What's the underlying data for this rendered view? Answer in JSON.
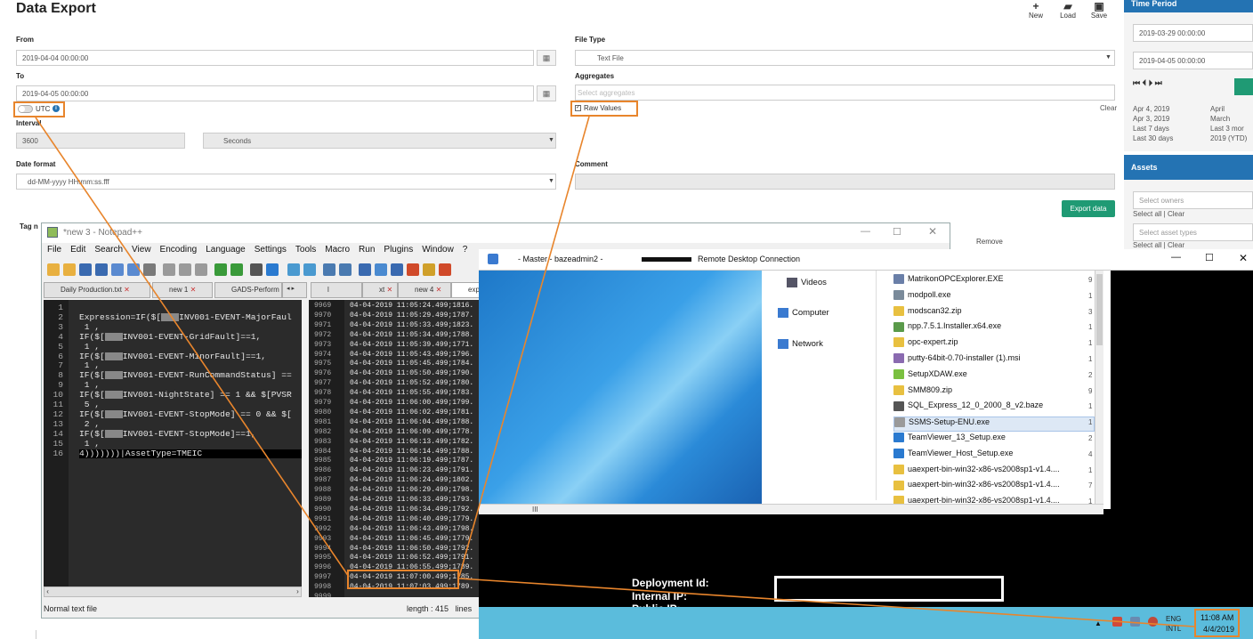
{
  "page": {
    "title": "Data Export",
    "toolbar": {
      "new_label": "New",
      "load_label": "Load",
      "save_label": "Save"
    }
  },
  "form": {
    "from_label": "From",
    "from_value": "2019-04-04 00:00:00",
    "to_label": "To",
    "to_value": "2019-04-05 00:00:00",
    "utc_label": "UTC",
    "interval_label": "Interval",
    "interval_value": "3600",
    "interval_unit": "Seconds",
    "date_format_label": "Date format",
    "date_format_value": "dd-MM-yyyy HH:mm:ss.fff",
    "file_type_label": "File Type",
    "file_type_value": "Text File",
    "aggregates_label": "Aggregates",
    "aggregates_placeholder": "Select aggregates",
    "raw_values_label": "Raw Values",
    "clear_label": "Clear",
    "comment_label": "Comment",
    "export_button": "Export data",
    "tag_label": "Tag n",
    "remove_label": "Remove"
  },
  "right_panel": {
    "time_period_heading": "Time Period",
    "start_value": "2019-03-29 00:00:00",
    "end_value": "2019-04-05 00:00:00",
    "nav_glyphs": "⏮ ⏴   ⏵ ⏭",
    "quick_left": [
      "Apr 4, 2019",
      "Apr 3, 2019",
      "Last 7 days",
      "Last 30 days"
    ],
    "quick_right": [
      "April",
      "March",
      "Last 3 mor",
      "2019 (YTD)"
    ],
    "assets_heading": "Assets",
    "owners_placeholder": "Select owners",
    "owners_links": "Select all | Clear",
    "asset_types_placeholder": "Select asset types",
    "asset_types_links": "Select all | Clear"
  },
  "notepad": {
    "title": "*new 3 - Notepad++",
    "menu": [
      "File",
      "Edit",
      "Search",
      "View",
      "Encoding",
      "Language",
      "Settings",
      "Tools",
      "Macro",
      "Run",
      "Plugins",
      "Window",
      "?"
    ],
    "tabs_left": [
      "Daily Production.txt",
      "new 1",
      "GADS-Perform"
    ],
    "tabs_right": [
      "l",
      "xt",
      "new 4",
      "exportec"
    ],
    "status_left": "Normal text file",
    "status_length": "length : 415",
    "status_lines": "lines",
    "editor_lines": [
      {
        "n": "1",
        "a": "",
        "r": false,
        "b": ""
      },
      {
        "n": "2",
        "a": "Expression=IF($[",
        "r": true,
        "b": "INV001-EVENT-MajorFaul"
      },
      {
        "n": "3",
        "a": " 1 ,",
        "r": false,
        "b": ""
      },
      {
        "n": "4",
        "a": "IF($[",
        "r": true,
        "b": "INV001-EVENT-GridFault]==1,"
      },
      {
        "n": "5",
        "a": " 1 ,",
        "r": false,
        "b": ""
      },
      {
        "n": "6",
        "a": "IF($[",
        "r": true,
        "b": "INV001-EVENT-MinorFault]==1,"
      },
      {
        "n": "7",
        "a": " 1 ,",
        "r": false,
        "b": ""
      },
      {
        "n": "8",
        "a": "IF($[",
        "r": true,
        "b": "INV001-EVENT-RunCommandStatus] =="
      },
      {
        "n": "9",
        "a": " 1 ,",
        "r": false,
        "b": ""
      },
      {
        "n": "10",
        "a": "IF($[",
        "r": true,
        "b": "INV001-NightState] == 1 && $[PVSR"
      },
      {
        "n": "11",
        "a": " 5 ,",
        "r": false,
        "b": ""
      },
      {
        "n": "12",
        "a": "IF($[",
        "r": true,
        "b": "INV001-EVENT-StopMode] == 0 && $["
      },
      {
        "n": "13",
        "a": " 2 ,",
        "r": false,
        "b": ""
      },
      {
        "n": "14",
        "a": "IF($[",
        "r": true,
        "b": "INV001-EVENT-StopMode]==1,"
      },
      {
        "n": "15",
        "a": " 1 ,",
        "r": false,
        "b": ""
      },
      {
        "n": "16",
        "a": "4)))))))|AssetType=TMEIC",
        "r": false,
        "b": ""
      }
    ],
    "data_lines": [
      {
        "n": "9969",
        "t": "04-04-2019 11:05:24.499;1816."
      },
      {
        "n": "9970",
        "t": "04-04-2019 11:05:29.499;1787."
      },
      {
        "n": "9971",
        "t": "04-04-2019 11:05:33.499;1823."
      },
      {
        "n": "9972",
        "t": "04-04-2019 11:05:34.499;1788."
      },
      {
        "n": "9973",
        "t": "04-04-2019 11:05:39.499;1771."
      },
      {
        "n": "9974",
        "t": "04-04-2019 11:05:43.499;1796."
      },
      {
        "n": "9975",
        "t": "04-04-2019 11:05:45.499;1784."
      },
      {
        "n": "9976",
        "t": "04-04-2019 11:05:50.499;1790."
      },
      {
        "n": "9977",
        "t": "04-04-2019 11:05:52.499;1780."
      },
      {
        "n": "9978",
        "t": "04-04-2019 11:05:55.499;1783."
      },
      {
        "n": "9979",
        "t": "04-04-2019 11:06:00.499;1799."
      },
      {
        "n": "9980",
        "t": "04-04-2019 11:06:02.499;1781."
      },
      {
        "n": "9981",
        "t": "04-04-2019 11:06:04.499;1788."
      },
      {
        "n": "9982",
        "t": "04-04-2019 11:06:09.499;1778."
      },
      {
        "n": "9983",
        "t": "04-04-2019 11:06:13.499;1782."
      },
      {
        "n": "9984",
        "t": "04-04-2019 11:06:14.499;1788."
      },
      {
        "n": "9985",
        "t": "04-04-2019 11:06:19.499;1787."
      },
      {
        "n": "9986",
        "t": "04-04-2019 11:06:23.499;1791."
      },
      {
        "n": "9987",
        "t": "04-04-2019 11:06:24.499;1802."
      },
      {
        "n": "9988",
        "t": "04-04-2019 11:06:29.499;1798."
      },
      {
        "n": "9989",
        "t": "04-04-2019 11:06:33.499;1793."
      },
      {
        "n": "9990",
        "t": "04-04-2019 11:06:34.499;1792."
      },
      {
        "n": "9991",
        "t": "04-04-2019 11:06:40.499;1779."
      },
      {
        "n": "9992",
        "t": "04-04-2019 11:06:43.499;1798."
      },
      {
        "n": "9993",
        "t": "04-04-2019 11:06:45.499;1779."
      },
      {
        "n": "9994",
        "t": "04-04-2019 11:06:50.499;1792."
      },
      {
        "n": "9995",
        "t": "04-04-2019 11:06:52.499;1791."
      },
      {
        "n": "9996",
        "t": "04-04-2019 11:06:55.499;1789."
      },
      {
        "n": "9997",
        "t": "04-04-2019 11:07:00.499;1785."
      },
      {
        "n": "9998",
        "t": "04-04-2019 11:07:03.499;1789."
      },
      {
        "n": "9999",
        "t": ""
      }
    ]
  },
  "rdp": {
    "title_prefix": "- Master - bazeadmin2 -",
    "title_suffix": "Remote Desktop Connection",
    "nav": [
      "Videos",
      "Computer",
      "Network"
    ],
    "files": [
      {
        "name": "MatrikonOPCExplorer.EXE",
        "size": "9",
        "color": "#6a7fa8"
      },
      {
        "name": "modpoll.exe",
        "size": "1",
        "color": "#7a8a9a"
      },
      {
        "name": "modscan32.zip",
        "size": "3",
        "color": "#e8c040"
      },
      {
        "name": "npp.7.5.1.Installer.x64.exe",
        "size": "1",
        "color": "#5a9a4a"
      },
      {
        "name": "opc-expert.zip",
        "size": "1",
        "color": "#e8c040"
      },
      {
        "name": "putty-64bit-0.70-installer (1).msi",
        "size": "1",
        "color": "#8a6ab0"
      },
      {
        "name": "SetupXDAW.exe",
        "size": "2",
        "color": "#7ac040"
      },
      {
        "name": "SMM809.zip",
        "size": "9",
        "color": "#e8c040"
      },
      {
        "name": "SQL_Express_12_0_2000_8_v2.baze",
        "size": "1",
        "color": "#555555"
      },
      {
        "name": "SSMS-Setup-ENU.exe",
        "size": "1",
        "color": "#9a9a9a"
      },
      {
        "name": "TeamViewer_13_Setup.exe",
        "size": "2",
        "color": "#2a7ad0"
      },
      {
        "name": "TeamViewer_Host_Setup.exe",
        "size": "4",
        "color": "#2a7ad0"
      },
      {
        "name": "uaexpert-bin-win32-x86-vs2008sp1-v1.4....",
        "size": "1",
        "color": "#e8c040"
      },
      {
        "name": "uaexpert-bin-win32-x86-vs2008sp1-v1.4....",
        "size": "7",
        "color": "#e8c040"
      },
      {
        "name": "uaexpert-bin-win32-x86-vs2008sp1-v1.4....",
        "size": "1",
        "color": "#e8c040"
      }
    ],
    "scroll_glyph": "III",
    "deployment_id": "Deployment Id:",
    "internal_ip": "Internal IP:",
    "public_ip": "Public IP:",
    "tray_lang": "ENG",
    "tray_lang2": "INTL",
    "clock_time": "11:08 AM",
    "clock_date": "4/4/2019"
  },
  "colors": {
    "accent": "#2473b3",
    "export_green": "#1f9a74",
    "annotation_orange": "#e8852c",
    "rdp_taskbar": "#5bbcdc"
  }
}
